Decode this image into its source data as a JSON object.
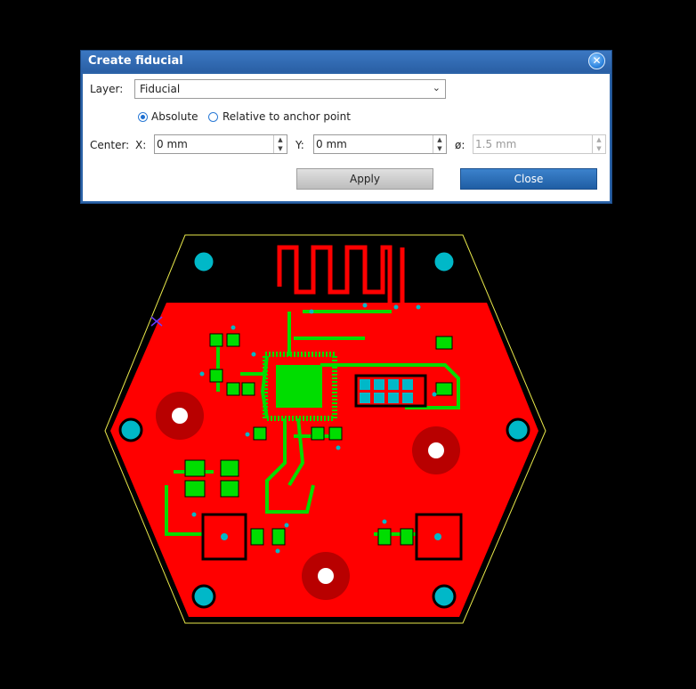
{
  "dialog": {
    "title": "Create fiducial",
    "layer_label": "Layer:",
    "layer_value": "Fiducial",
    "mode_options": [
      {
        "label": "Absolute",
        "selected": true
      },
      {
        "label": "Relative to anchor point",
        "selected": false
      }
    ],
    "center_label": "Center:",
    "x_label": "X:",
    "x_value": "0 mm",
    "y_label": "Y:",
    "y_value": "0 mm",
    "diameter_label": "ø:",
    "diameter_value": "1.5 mm",
    "apply_label": "Apply",
    "close_label": "Close"
  },
  "colors": {
    "copper_top": "#ff0000",
    "traces": "#00dd00",
    "fiducial": "#00b8c8",
    "outline": "#e8e84a",
    "dialog_accent": "#2b63a8"
  },
  "icons": [
    "close-icon",
    "chevron-down-icon",
    "spin-up-icon",
    "spin-down-icon"
  ]
}
